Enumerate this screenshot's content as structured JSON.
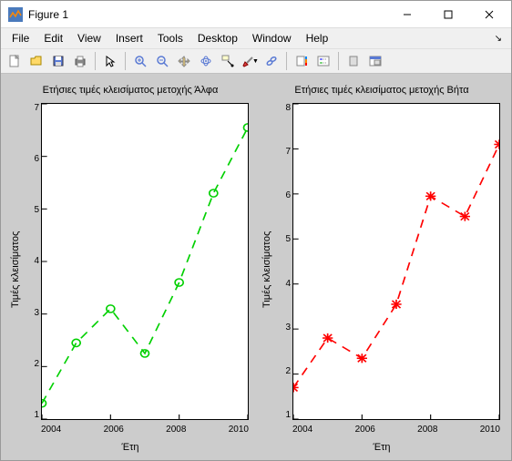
{
  "window": {
    "title": "Figure 1"
  },
  "menu": {
    "file": "File",
    "edit": "Edit",
    "view": "View",
    "insert": "Insert",
    "tools": "Tools",
    "desktop": "Desktop",
    "window": "Window",
    "help": "Help"
  },
  "toolbar_icons": [
    "new",
    "open",
    "save",
    "print",
    "pointer",
    "zoom-in",
    "zoom-out",
    "pan",
    "rotate",
    "datacursor",
    "brush",
    "link",
    "colorbar",
    "legend",
    "hide",
    "dock"
  ],
  "chart_data": [
    {
      "type": "line",
      "title": "Ετήσιες τιμές κλεισίματος μετοχής Άλφα",
      "xlabel": "Έτη",
      "ylabel": "Τιμές κλεισίματος",
      "x": [
        2004,
        2005,
        2006,
        2007,
        2008,
        2009,
        2010
      ],
      "y": [
        1.3,
        2.45,
        3.1,
        2.25,
        3.6,
        5.3,
        6.55
      ],
      "xticks": [
        2004,
        2006,
        2008,
        2010
      ],
      "yticks": [
        1,
        2,
        3,
        4,
        5,
        6,
        7
      ],
      "xlim": [
        2004,
        2010
      ],
      "ylim": [
        1,
        7
      ],
      "color": "#00d000",
      "marker": "circle",
      "linestyle": "dashed"
    },
    {
      "type": "line",
      "title": "Ετήσιες τιμές κλεισίματος μετοχής Βήτα",
      "xlabel": "Έτη",
      "ylabel": "Τιμές κλεισίματος",
      "x": [
        2004,
        2005,
        2006,
        2007,
        2008,
        2009,
        2010
      ],
      "y": [
        1.7,
        2.8,
        2.35,
        3.55,
        5.95,
        5.5,
        7.1
      ],
      "xticks": [
        2004,
        2006,
        2008,
        2010
      ],
      "yticks": [
        1,
        2,
        3,
        4,
        5,
        6,
        7,
        8
      ],
      "xlim": [
        2004,
        2010
      ],
      "ylim": [
        1,
        8
      ],
      "color": "#ff0000",
      "marker": "star",
      "linestyle": "dashed"
    }
  ]
}
